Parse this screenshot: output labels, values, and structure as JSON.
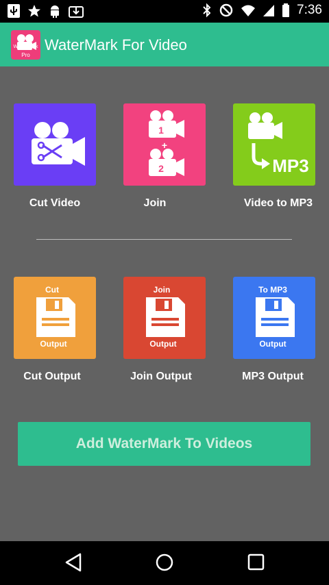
{
  "status_bar": {
    "time": "7:36",
    "left_icons": [
      "usb-icon",
      "star-icon",
      "android-icon",
      "download-icon"
    ],
    "right_icons": [
      "bluetooth-icon",
      "no-disturb-icon",
      "wifi-icon",
      "signal-icon",
      "battery-icon"
    ]
  },
  "app_bar": {
    "title": "WaterMark For Video",
    "logo_top_text": "Water Mark",
    "logo_bottom_text": "Pro"
  },
  "tiles_row1": [
    {
      "label": "Cut Video",
      "icon": "cut-video-icon",
      "color": "#6a3ef5"
    },
    {
      "label": "Join",
      "icon": "join-video-icon",
      "color": "#f2427f"
    },
    {
      "label": "Video to MP3",
      "icon": "video-to-mp3-icon",
      "color": "#84cc1b",
      "icon_text": "MP3"
    }
  ],
  "tiles_row2": [
    {
      "label": "Cut Output",
      "icon": "cut-output-icon",
      "color": "#f0a03c",
      "top_text": "Cut",
      "bottom_text": "Output"
    },
    {
      "label": "Join Output",
      "icon": "join-output-icon",
      "color": "#d94732",
      "top_text": "Join",
      "bottom_text": "Output"
    },
    {
      "label": "MP3 Output",
      "icon": "mp3-output-icon",
      "color": "#3b77f0",
      "top_text": "To MP3",
      "bottom_text": "Output"
    }
  ],
  "cta": {
    "label": "Add WaterMark To Videos"
  },
  "nav_bar": {
    "buttons": [
      "back-icon",
      "home-icon",
      "recents-icon"
    ]
  }
}
